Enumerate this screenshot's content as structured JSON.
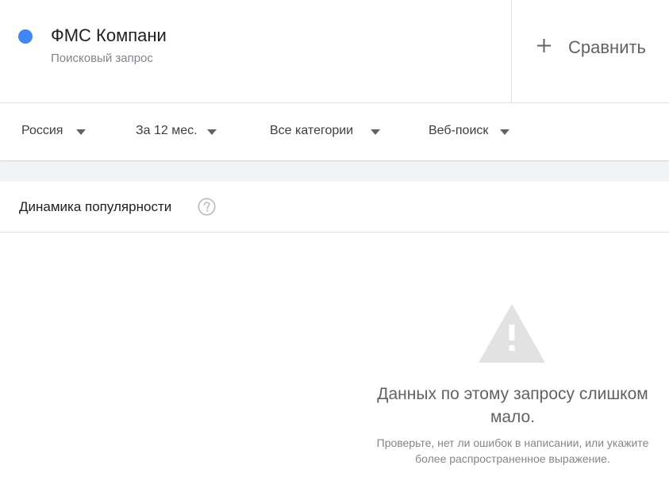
{
  "term": {
    "title": "ФМС Компани",
    "subtitle": "Поисковый запрос",
    "color": "#4285f4"
  },
  "compare": {
    "icon": "plus-icon",
    "label": "Сравнить"
  },
  "filters": [
    {
      "label": "Россия",
      "icon": "caret-down-icon"
    },
    {
      "label": "За 12 мес.",
      "icon": "caret-down-icon"
    },
    {
      "label": "Все категории",
      "icon": "caret-down-icon"
    },
    {
      "label": "Веб-поиск",
      "icon": "caret-down-icon"
    }
  ],
  "section": {
    "title": "Динамика популярности",
    "help_icon": "help-icon"
  },
  "empty_state": {
    "icon": "warning-icon",
    "message": "Данных по этому запросу слишком мало.",
    "hint": "Проверьте, нет ли ошибок в написании, или укажите более распространенное выражение."
  }
}
